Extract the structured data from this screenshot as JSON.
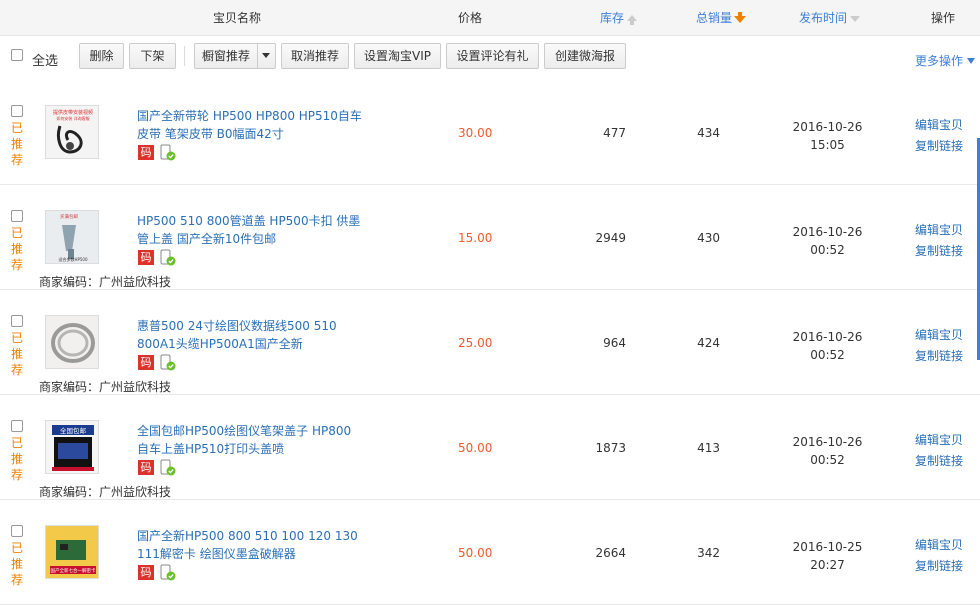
{
  "header": {
    "name": "宝贝名称",
    "price": "价格",
    "stock": "库存",
    "sales": "总销量",
    "date": "发布时间",
    "op": "操作"
  },
  "toolbar": {
    "select_all": "全选",
    "delete": "删除",
    "offshelf": "下架",
    "window_recommend": "橱窗推荐",
    "cancel_recommend": "取消推荐",
    "set_vip": "设置淘宝VIP",
    "set_review_gift": "设置评论有礼",
    "create_weitao_poster": "创建微海报",
    "more_ops": "更多操作"
  },
  "rows": [
    {
      "recommended": "已推荐",
      "title": "国产全新带轮 HP500 HP800 HP510自车皮带 笔架皮带 B0幅面42寸",
      "price": "30.00",
      "stock": "477",
      "sales": "434",
      "date": "2016-10-26",
      "time": "15:05",
      "sku": "",
      "edit": "编辑宝贝",
      "copy": "复制链接",
      "thumb_text": "提供皮带安装视频",
      "thumb_subtext": "如何安装 详询客服"
    },
    {
      "recommended": "已推荐",
      "title": "HP500 510 800管道盖 HP500卡扣 供墨管上盖 国产全新10件包邮",
      "price": "15.00",
      "stock": "2949",
      "sales": "430",
      "date": "2016-10-26",
      "time": "00:52",
      "sku": "商家编码：广州益欣科技",
      "edit": "编辑宝贝",
      "copy": "复制链接",
      "thumb_text": "买满包邮",
      "thumb_subtext": "适合多数HP500"
    },
    {
      "recommended": "已推荐",
      "title": "惠普500 24寸绘图仪数据线500 510 800A1头缆HP500A1国产全新",
      "price": "25.00",
      "stock": "964",
      "sales": "424",
      "date": "2016-10-26",
      "time": "00:52",
      "sku": "商家编码：广州益欣科技",
      "edit": "编辑宝贝",
      "copy": "复制链接",
      "thumb_text": "",
      "thumb_subtext": ""
    },
    {
      "recommended": "已推荐",
      "title": "全国包邮HP500绘图仪笔架盖子 HP800自车上盖HP510打印头盖喷",
      "price": "50.00",
      "stock": "1873",
      "sales": "413",
      "date": "2016-10-26",
      "time": "00:52",
      "sku": "商家编码：广州益欣科技",
      "edit": "编辑宝贝",
      "copy": "复制链接",
      "thumb_text": "全国包邮",
      "thumb_subtext": ""
    },
    {
      "recommended": "已推荐",
      "title": "国产全新HP500 800 510 100 120 130 111解密卡 绘图仪墨盒破解器",
      "price": "50.00",
      "stock": "2664",
      "sales": "342",
      "date": "2016-10-25",
      "time": "20:27",
      "sku": "",
      "edit": "编辑宝贝",
      "copy": "复制链接",
      "thumb_text": "国产全新七合一解密卡",
      "thumb_subtext": ""
    }
  ],
  "badges": {
    "ma": "码"
  },
  "colors": {
    "link": "#2a6fb7",
    "price": "#f05a28",
    "recommend": "#f08100",
    "sort_active": "#f08100",
    "ma_badge": "#d9332b"
  }
}
